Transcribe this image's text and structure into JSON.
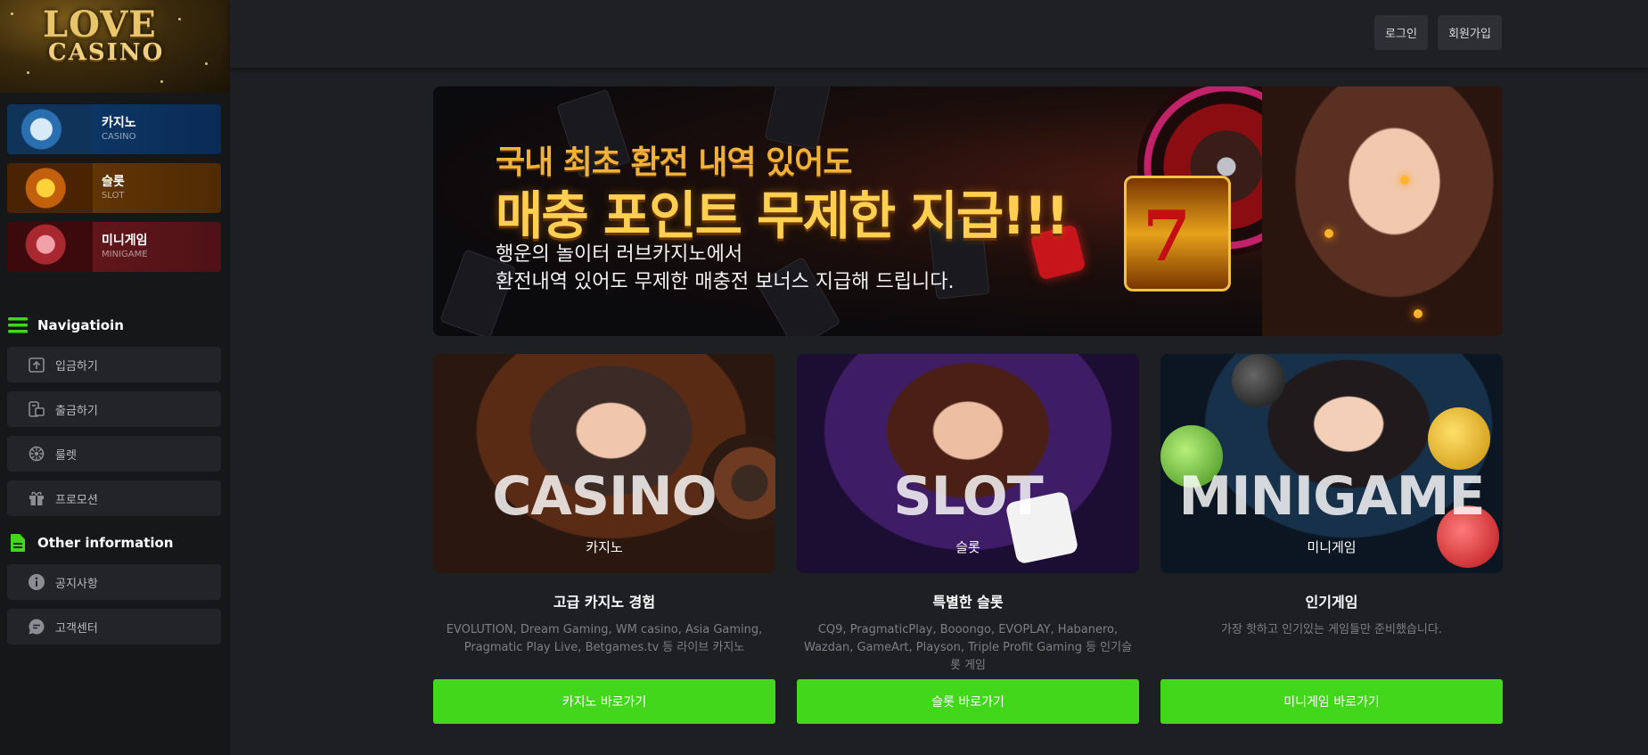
{
  "brand": {
    "logo_line1": "LOVE",
    "logo_line2": "CASINO"
  },
  "sidebar": {
    "game_categories": [
      {
        "label": "카지노",
        "sub": "CASINO"
      },
      {
        "label": "슬롯",
        "sub": "SLOT"
      },
      {
        "label": "미니게임",
        "sub": "MINIGAME"
      }
    ],
    "nav_title": "Navigatioin",
    "nav_items": [
      {
        "label": "입금하기",
        "icon": "deposit-icon"
      },
      {
        "label": "출금하기",
        "icon": "withdraw-icon"
      },
      {
        "label": "룰렛",
        "icon": "roulette-icon"
      },
      {
        "label": "프로모션",
        "icon": "gift-icon"
      }
    ],
    "other_title": "Other information",
    "other_items": [
      {
        "label": "공지사항",
        "icon": "info-icon"
      },
      {
        "label": "고객센터",
        "icon": "chat-icon"
      }
    ]
  },
  "header": {
    "login_label": "로그인",
    "join_label": "회원가입"
  },
  "banner": {
    "line1": "국내 최초 환전 내역 있어도",
    "line2": "매충 포인트 무제한 지급!!!",
    "line3": "행운의 놀이터 러브카지노에서",
    "line4": "환전내역 있어도 무제한 매충전 보너스 지급해 드립니다."
  },
  "games": [
    {
      "big": "CASINO",
      "small": "카지노",
      "title": "고급 카지노 경험",
      "desc": "EVOLUTION, Dream Gaming, WM casino, Asia Gaming, Pragmatic Play Live, Betgames.tv 등 라이브 카지노",
      "button": "카지노 바로가기"
    },
    {
      "big": "SLOT",
      "small": "슬롯",
      "title": "특별한 슬롯",
      "desc": "CQ9, PragmaticPlay, Booongo, EVOPLAY, Habanero, Wazdan, GameArt, Playson, Triple Profit Gaming 등 인기슬롯 게임",
      "button": "슬롯 바로가기"
    },
    {
      "big": "MINIGAME",
      "small": "미니게임",
      "title": "인기게임",
      "desc": "가장 핫하고 인기있는 게임들만 준비했습니다.",
      "button": "미니게임 바로가기"
    }
  ],
  "colors": {
    "accent": "#43d71c",
    "background": "#1d1f23",
    "sidebar": "#161719"
  }
}
